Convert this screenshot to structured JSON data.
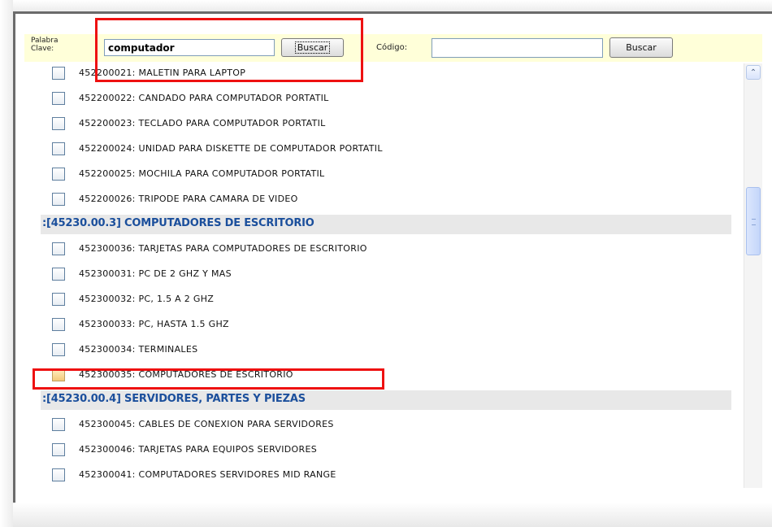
{
  "search": {
    "keyword_label_line1": "Palabra",
    "keyword_label_line2": "Clave:",
    "keyword_value": "computador",
    "keyword_button": "Buscar",
    "code_label": "Código:",
    "code_value": "",
    "code_button": "Buscar"
  },
  "rows": [
    {
      "kind": "item",
      "text": "452200021: MALETIN PARA LAPTOP",
      "checked": false
    },
    {
      "kind": "item",
      "text": "452200022: CANDADO PARA COMPUTADOR PORTATIL",
      "checked": false
    },
    {
      "kind": "item",
      "text": "452200023: TECLADO PARA COMPUTADOR PORTATIL",
      "checked": false
    },
    {
      "kind": "item",
      "text": "452200024: UNIDAD PARA DISKETTE DE COMPUTADOR PORTATIL",
      "checked": false
    },
    {
      "kind": "item",
      "text": "452200025: MOCHILA PARA COMPUTADOR PORTATIL",
      "checked": false
    },
    {
      "kind": "item",
      "text": "452200026: TRIPODE PARA CAMARA DE VIDEO",
      "checked": false
    },
    {
      "kind": "category",
      "text": ":[45230.00.3] COMPUTADORES DE ESCRITORIO"
    },
    {
      "kind": "item",
      "text": "452300036: TARJETAS PARA COMPUTADORES DE ESCRITORIO",
      "checked": false
    },
    {
      "kind": "item",
      "text": "452300031: PC DE 2 GHZ Y MAS",
      "checked": false
    },
    {
      "kind": "item",
      "text": "452300032: PC, 1.5 A 2 GHZ",
      "checked": false
    },
    {
      "kind": "item",
      "text": "452300033: PC, HASTA 1.5 GHZ",
      "checked": false
    },
    {
      "kind": "item",
      "text": "452300034: TERMINALES",
      "checked": false
    },
    {
      "kind": "item",
      "text": "452300035: COMPUTADORES DE ESCRITORIO",
      "checked": true
    },
    {
      "kind": "category",
      "text": ":[45230.00.4] SERVIDORES, PARTES Y PIEZAS"
    },
    {
      "kind": "item",
      "text": "452300045: CABLES DE CONEXION PARA SERVIDORES",
      "checked": false
    },
    {
      "kind": "item",
      "text": "452300046: TARJETAS PARA EQUIPOS SERVIDORES",
      "checked": false
    },
    {
      "kind": "item",
      "text": "452300041: COMPUTADORES SERVIDORES MID RANGE",
      "checked": false
    }
  ],
  "scrollbar": {
    "up_arrow_glyph": "⌃"
  },
  "colors": {
    "highlight": "#ee1111",
    "category_text": "#1b4f9c",
    "search_bar_bg": "#ffffd9"
  }
}
